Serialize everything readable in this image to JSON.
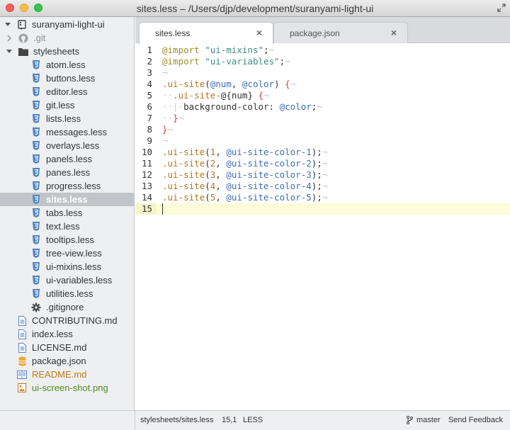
{
  "window": {
    "title": "sites.less – /Users/djp/development/suranyami-light-ui"
  },
  "tree": {
    "root": "suranyami-light-ui",
    "items": [
      {
        "label": "suranyami-light-ui",
        "icon": "repo-icon",
        "kind": "root",
        "expanded": true
      },
      {
        "label": ".git",
        "icon": "github-icon",
        "kind": "dir",
        "expanded": false,
        "muted": true
      },
      {
        "label": "stylesheets",
        "icon": "folder-icon",
        "kind": "dir",
        "expanded": true
      },
      {
        "label": "atom.less",
        "icon": "css3-icon",
        "kind": "file"
      },
      {
        "label": "buttons.less",
        "icon": "css3-icon",
        "kind": "file"
      },
      {
        "label": "editor.less",
        "icon": "css3-icon",
        "kind": "file"
      },
      {
        "label": "git.less",
        "icon": "css3-icon",
        "kind": "file"
      },
      {
        "label": "lists.less",
        "icon": "css3-icon",
        "kind": "file"
      },
      {
        "label": "messages.less",
        "icon": "css3-icon",
        "kind": "file"
      },
      {
        "label": "overlays.less",
        "icon": "css3-icon",
        "kind": "file"
      },
      {
        "label": "panels.less",
        "icon": "css3-icon",
        "kind": "file"
      },
      {
        "label": "panes.less",
        "icon": "css3-icon",
        "kind": "file"
      },
      {
        "label": "progress.less",
        "icon": "css3-icon",
        "kind": "file"
      },
      {
        "label": "sites.less",
        "icon": "css3-icon",
        "kind": "file",
        "selected": true
      },
      {
        "label": "tabs.less",
        "icon": "css3-icon",
        "kind": "file"
      },
      {
        "label": "text.less",
        "icon": "css3-icon",
        "kind": "file"
      },
      {
        "label": "tooltips.less",
        "icon": "css3-icon",
        "kind": "file"
      },
      {
        "label": "tree-view.less",
        "icon": "css3-icon",
        "kind": "file"
      },
      {
        "label": "ui-mixins.less",
        "icon": "css3-icon",
        "kind": "file"
      },
      {
        "label": "ui-variables.less",
        "icon": "css3-icon",
        "kind": "file"
      },
      {
        "label": "utilities.less",
        "icon": "css3-icon",
        "kind": "file"
      },
      {
        "label": ".gitignore",
        "icon": "gear-icon",
        "kind": "file"
      },
      {
        "label": "CONTRIBUTING.md",
        "icon": "document-icon",
        "kind": "file"
      },
      {
        "label": "index.less",
        "icon": "document-icon",
        "kind": "file"
      },
      {
        "label": "LICENSE.md",
        "icon": "document-icon",
        "kind": "file"
      },
      {
        "label": "package.json",
        "icon": "database-icon",
        "kind": "file"
      },
      {
        "label": "README.md",
        "icon": "book-icon",
        "kind": "file",
        "color": "orange"
      },
      {
        "label": "ui-screen-shot.png",
        "icon": "image-icon",
        "kind": "file",
        "color": "green"
      }
    ]
  },
  "tabs": [
    {
      "label": "sites.less",
      "active": true,
      "close": "×"
    },
    {
      "label": "package.json",
      "active": false,
      "close": "×"
    }
  ],
  "editor": {
    "current_line": 15,
    "invisible_eol": "¬",
    "lines": [
      {
        "no": "1",
        "tokens": [
          [
            "kw",
            "@import "
          ],
          [
            "str",
            "\"ui-mixins\""
          ],
          [
            "prop",
            ";"
          ],
          [
            "inv",
            "¬"
          ]
        ]
      },
      {
        "no": "2",
        "tokens": [
          [
            "kw",
            "@import "
          ],
          [
            "str",
            "\"ui-variables\""
          ],
          [
            "prop",
            ";"
          ],
          [
            "inv",
            "¬"
          ]
        ]
      },
      {
        "no": "3",
        "tokens": [
          [
            "inv",
            "¬"
          ]
        ]
      },
      {
        "no": "4",
        "tokens": [
          [
            "sel",
            ".ui-site"
          ],
          [
            "prop",
            "("
          ],
          [
            "var",
            "@num"
          ],
          [
            "prop",
            ", "
          ],
          [
            "var",
            "@color"
          ],
          [
            "prop",
            ") "
          ],
          [
            "pun",
            "{"
          ],
          [
            "inv",
            "¬"
          ]
        ]
      },
      {
        "no": "5",
        "tokens": [
          [
            "inv",
            "··"
          ],
          [
            "sel",
            ".ui-site-"
          ],
          [
            "prop",
            "@{"
          ],
          [
            "prop",
            "num"
          ],
          [
            "prop",
            "} "
          ],
          [
            "pun",
            "{"
          ],
          [
            "inv",
            "¬"
          ]
        ]
      },
      {
        "no": "6",
        "tokens": [
          [
            "inv",
            "··|·"
          ],
          [
            "prop",
            "background-color: "
          ],
          [
            "var",
            "@color"
          ],
          [
            "prop",
            ";"
          ],
          [
            "inv",
            "¬"
          ]
        ]
      },
      {
        "no": "7",
        "tokens": [
          [
            "inv",
            "··"
          ],
          [
            "pun",
            "}"
          ],
          [
            "inv",
            "¬"
          ]
        ]
      },
      {
        "no": "8",
        "tokens": [
          [
            "pun",
            "}"
          ],
          [
            "inv",
            "¬"
          ]
        ]
      },
      {
        "no": "9",
        "tokens": [
          [
            "inv",
            "¬"
          ]
        ]
      },
      {
        "no": "10",
        "tokens": [
          [
            "sel",
            ".ui-site"
          ],
          [
            "prop",
            "("
          ],
          [
            "num",
            "1"
          ],
          [
            "prop",
            ", "
          ],
          [
            "var",
            "@ui-site-color-1"
          ],
          [
            "prop",
            ");"
          ],
          [
            "inv",
            "¬"
          ]
        ]
      },
      {
        "no": "11",
        "tokens": [
          [
            "sel",
            ".ui-site"
          ],
          [
            "prop",
            "("
          ],
          [
            "num",
            "2"
          ],
          [
            "prop",
            ", "
          ],
          [
            "var",
            "@ui-site-color-2"
          ],
          [
            "prop",
            ");"
          ],
          [
            "inv",
            "¬"
          ]
        ]
      },
      {
        "no": "12",
        "tokens": [
          [
            "sel",
            ".ui-site"
          ],
          [
            "prop",
            "("
          ],
          [
            "num",
            "3"
          ],
          [
            "prop",
            ", "
          ],
          [
            "var",
            "@ui-site-color-3"
          ],
          [
            "prop",
            ");"
          ],
          [
            "inv",
            "¬"
          ]
        ]
      },
      {
        "no": "13",
        "tokens": [
          [
            "sel",
            ".ui-site"
          ],
          [
            "prop",
            "("
          ],
          [
            "num",
            "4"
          ],
          [
            "prop",
            ", "
          ],
          [
            "var",
            "@ui-site-color-4"
          ],
          [
            "prop",
            ");"
          ],
          [
            "inv",
            "¬"
          ]
        ]
      },
      {
        "no": "14",
        "tokens": [
          [
            "sel",
            ".ui-site"
          ],
          [
            "prop",
            "("
          ],
          [
            "num",
            "5"
          ],
          [
            "prop",
            ", "
          ],
          [
            "var",
            "@ui-site-color-5"
          ],
          [
            "prop",
            ");"
          ],
          [
            "inv",
            "¬"
          ]
        ]
      },
      {
        "no": "15",
        "tokens": []
      }
    ]
  },
  "status": {
    "path": "stylesheets/sites.less",
    "position": "15,1",
    "grammar": "LESS",
    "branch": "master",
    "feedback": "Send Feedback"
  },
  "colors": {
    "accent_selection": "#c1c5ca",
    "readme": "#c27a12",
    "image_file": "#4d8c1f"
  }
}
